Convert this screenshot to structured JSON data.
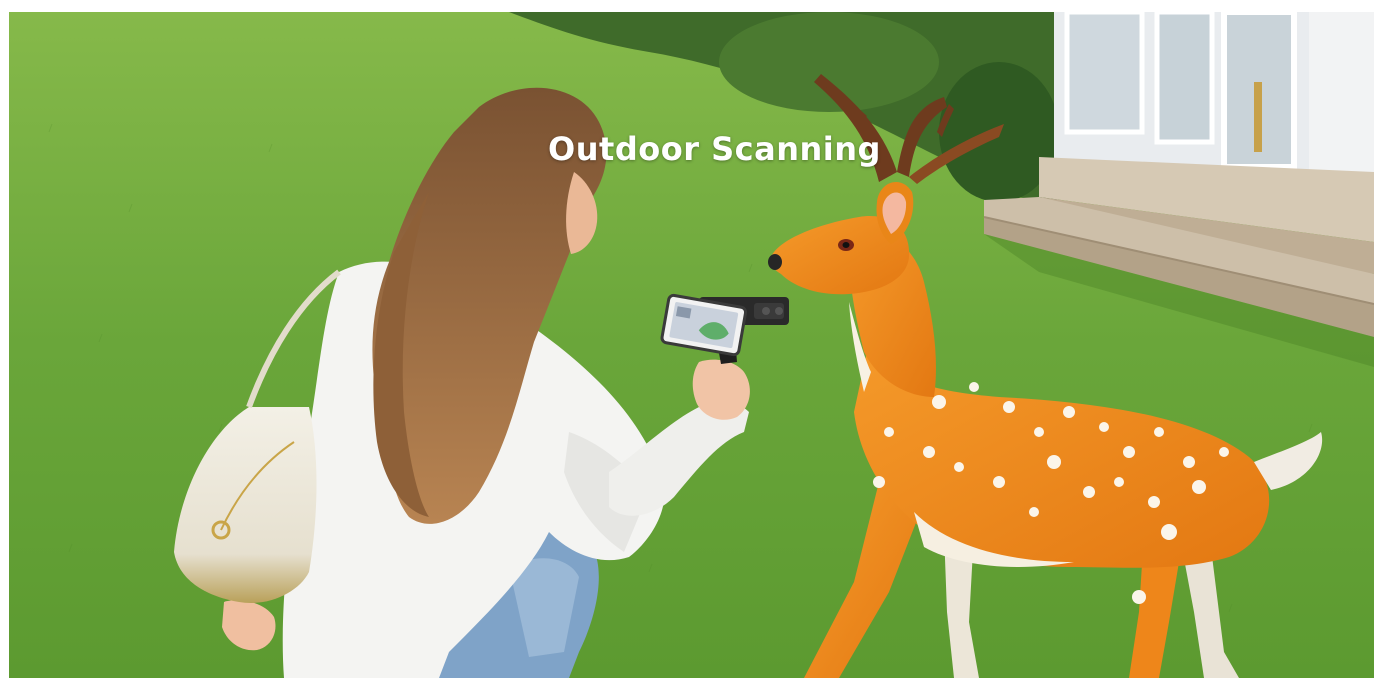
{
  "banner": {
    "headline": "Outdoor Scanning"
  },
  "palette": {
    "grass": "#6ea83c",
    "deer_body": "#f08a1c",
    "shirt": "#f4f4f2",
    "jeans": "#7fa3c8",
    "hair": "#9a6a3c",
    "house": "#e9ecef",
    "deck": "#c9bba8"
  }
}
